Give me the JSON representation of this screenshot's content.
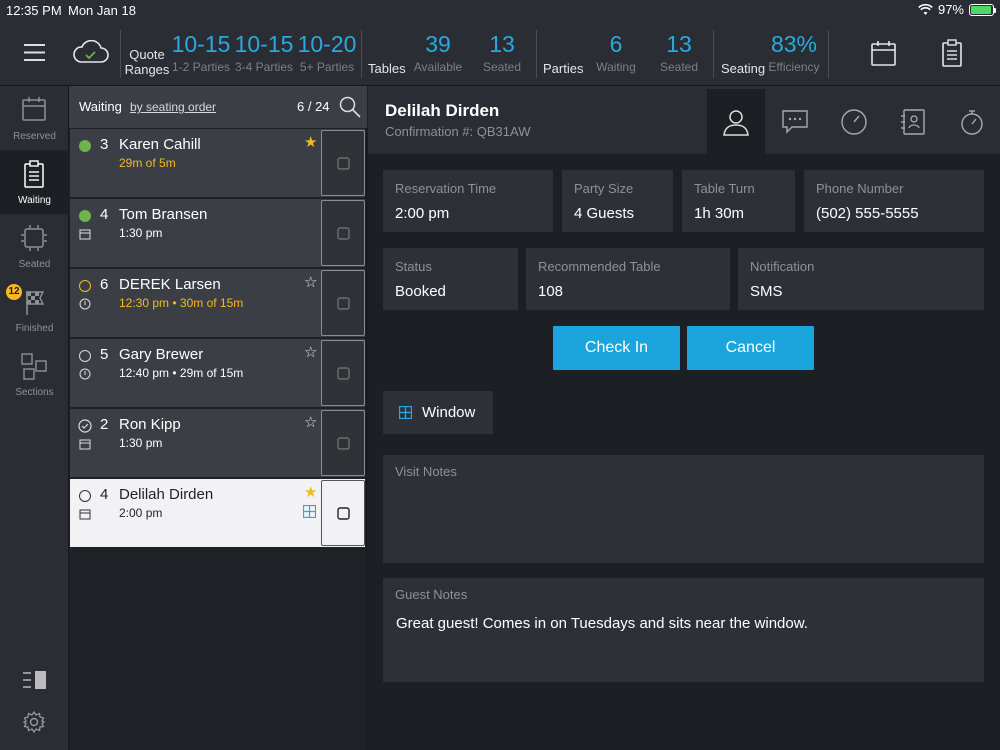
{
  "status_bar": {
    "time": "12:35 PM",
    "date": "Mon Jan 18",
    "battery": "97%",
    "battery_level": 0.97
  },
  "header": {
    "quote_label_1": "Quote",
    "quote_label_2": "Ranges",
    "ranges": [
      {
        "value": "10-15",
        "label": "1-2 Parties"
      },
      {
        "value": "10-15",
        "label": "3-4 Parties"
      },
      {
        "value": "10-20",
        "label": "5+ Parties"
      }
    ],
    "tables_label": "Tables",
    "tables": [
      {
        "value": "39",
        "label": "Available"
      },
      {
        "value": "13",
        "label": "Seated"
      }
    ],
    "parties_label": "Parties",
    "parties": [
      {
        "value": "6",
        "label": "Waiting"
      },
      {
        "value": "13",
        "label": "Seated"
      }
    ],
    "seating_label": "Seating",
    "efficiency": {
      "value": "83%",
      "label": "Efficiency"
    }
  },
  "sidebar": {
    "items": [
      {
        "label": "Reserved"
      },
      {
        "label": "Waiting"
      },
      {
        "label": "Seated"
      },
      {
        "label": "Finished"
      },
      {
        "label": "Sections"
      }
    ],
    "finished_badge": "12"
  },
  "waitlist": {
    "title": "Waiting",
    "sort": "by seating order",
    "count": "6 / 24",
    "rows": [
      {
        "size": "3",
        "name": "Karen Cahill",
        "time": "29m of 5m"
      },
      {
        "size": "4",
        "name": "Tom Bransen",
        "time": "1:30 pm"
      },
      {
        "size": "6",
        "name": "DEREK Larsen",
        "time": "12:30 pm  •  30m of 15m"
      },
      {
        "size": "5",
        "name": "Gary Brewer",
        "time": "12:40 pm  •  29m of 15m"
      },
      {
        "size": "2",
        "name": "Ron Kipp",
        "time": "1:30 pm"
      },
      {
        "size": "4",
        "name": "Delilah Dirden",
        "time": "2:00 pm"
      }
    ]
  },
  "detail": {
    "guest_name": "Delilah Dirden",
    "confirmation": "Confirmation #: QB31AW",
    "fields": {
      "reservation_time": {
        "label": "Reservation Time",
        "value": "2:00 pm"
      },
      "party_size": {
        "label": "Party Size",
        "value": "4 Guests"
      },
      "table_turn": {
        "label": "Table Turn",
        "value": "1h 30m"
      },
      "phone": {
        "label": "Phone Number",
        "value": "(502) 555-5555"
      },
      "status": {
        "label": "Status",
        "value": "Booked"
      },
      "recommended_table": {
        "label": "Recommended Table",
        "value": "108"
      },
      "notification": {
        "label": "Notification",
        "value": "SMS"
      }
    },
    "check_in_label": "Check In",
    "cancel_label": "Cancel",
    "seating_tag": "Window",
    "visit_notes_label": "Visit Notes",
    "visit_notes": "",
    "guest_notes_label": "Guest Notes",
    "guest_notes": "Great guest! Comes in on Tuesdays and sits near the window."
  },
  "colors": {
    "accent": "#29a9e0",
    "button": "#1aa5dc",
    "green": "#6fb14b",
    "yellow": "#f5b921"
  }
}
